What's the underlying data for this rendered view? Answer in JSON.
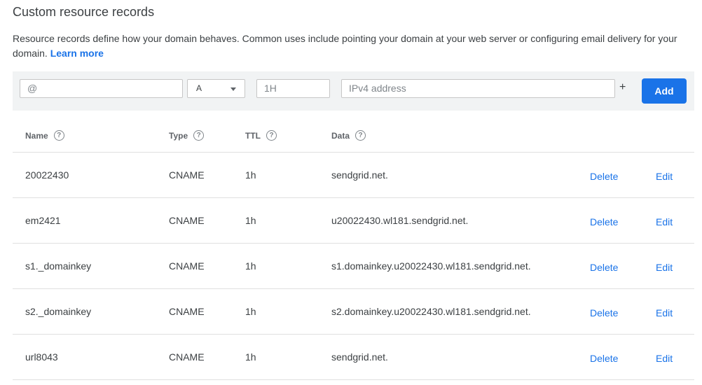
{
  "page": {
    "title": "Custom resource records",
    "description": "Resource records define how your domain behaves. Common uses include pointing your domain at your web server or configuring email delivery for your domain.",
    "learn_more": "Learn more"
  },
  "form": {
    "name_placeholder": "@",
    "type_value": "A",
    "ttl_placeholder": "1H",
    "data_placeholder": "IPv4 address",
    "plus_label": "+",
    "add_label": "Add"
  },
  "table": {
    "headers": {
      "name": "Name",
      "type": "Type",
      "ttl": "TTL",
      "data": "Data"
    },
    "rows": [
      {
        "name": "20022430",
        "type": "CNAME",
        "ttl": "1h",
        "data": "sendgrid.net."
      },
      {
        "name": "em2421",
        "type": "CNAME",
        "ttl": "1h",
        "data": "u20022430.wl181.sendgrid.net."
      },
      {
        "name": "s1._domainkey",
        "type": "CNAME",
        "ttl": "1h",
        "data": "s1.domainkey.u20022430.wl181.sendgrid.net."
      },
      {
        "name": "s2._domainkey",
        "type": "CNAME",
        "ttl": "1h",
        "data": "s2.domainkey.u20022430.wl181.sendgrid.net."
      },
      {
        "name": "url8043",
        "type": "CNAME",
        "ttl": "1h",
        "data": "sendgrid.net."
      }
    ],
    "delete_label": "Delete",
    "edit_label": "Edit"
  },
  "icons": {
    "help": "help-circle-icon"
  },
  "colors": {
    "accent": "#1a73e8",
    "form_background": "#f1f3f4",
    "divider": "#e0e0e0"
  }
}
